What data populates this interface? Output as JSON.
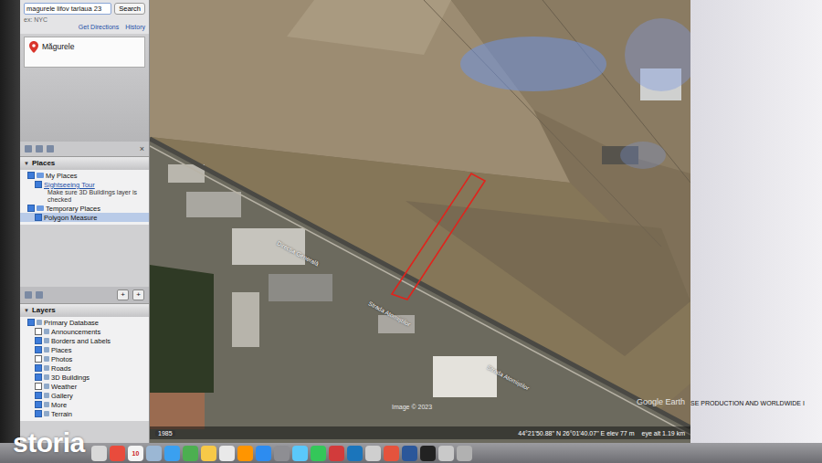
{
  "search": {
    "value": "magurele lifov tarlaua 23",
    "button": "Search",
    "hint": "ex: NYC",
    "links": [
      "Get Directions",
      "History"
    ]
  },
  "result": {
    "title": "Măgurele"
  },
  "toolbar": {
    "close": "×"
  },
  "places": {
    "toggle": "▼",
    "header": "Places",
    "items": [
      {
        "label": "My Places",
        "kind": "folder",
        "checked": true,
        "selected": false
      },
      {
        "label": "Sightseeing Tour",
        "kind": "link",
        "checked": true,
        "selected": false
      },
      {
        "label": "Make sure 3D Buildings layer is checked",
        "kind": "note",
        "checked": false,
        "selected": false
      },
      {
        "label": "Temporary Places",
        "kind": "folder",
        "checked": true,
        "selected": false
      },
      {
        "label": "Polygon Measure",
        "kind": "item",
        "checked": true,
        "selected": true
      }
    ]
  },
  "layers_toolbar": {
    "buttons": [
      "+",
      "+"
    ]
  },
  "layers": {
    "toggle": "▼",
    "header": "Layers",
    "items": [
      {
        "label": "Primary Database",
        "kind": "folder",
        "checked": true
      },
      {
        "label": "Announcements",
        "kind": "item",
        "checked": false
      },
      {
        "label": "Borders and Labels",
        "kind": "item",
        "checked": true
      },
      {
        "label": "Places",
        "kind": "item",
        "checked": true
      },
      {
        "label": "Photos",
        "kind": "item",
        "checked": false
      },
      {
        "label": "Roads",
        "kind": "item",
        "checked": true
      },
      {
        "label": "3D Buildings",
        "kind": "item",
        "checked": true
      },
      {
        "label": "Weather",
        "kind": "item",
        "checked": false
      },
      {
        "label": "Gallery",
        "kind": "item",
        "checked": true
      },
      {
        "label": "More",
        "kind": "item",
        "checked": true
      },
      {
        "label": "Terrain",
        "kind": "item",
        "checked": true
      }
    ]
  },
  "map": {
    "labels": [
      "Direcția Generală",
      "Strada Atomiștilor",
      "Strada Atomiștilor"
    ],
    "year": "1985",
    "copyright": "Image © 2023",
    "coords": "44°21'50.88\" N  26°01'40.07\" E  elev  77 m",
    "eye": "eye alt  1.19 km",
    "brand": "Google Earth"
  },
  "right": {
    "banner": "SE PRODUCTION AND WORLDWIDE I"
  },
  "watermark": {
    "text": "storia"
  },
  "dock": [
    {
      "color": "#d8d8d8",
      "label": ""
    },
    {
      "color": "#e94b3c",
      "label": ""
    },
    {
      "color": "#f4f4f4",
      "label": "10"
    },
    {
      "color": "#9bb7d4",
      "label": ""
    },
    {
      "color": "#3aa0f0",
      "label": ""
    },
    {
      "color": "#4caf50",
      "label": ""
    },
    {
      "color": "#f7c948",
      "label": ""
    },
    {
      "color": "#e9e9e9",
      "label": ""
    },
    {
      "color": "#ff9500",
      "label": ""
    },
    {
      "color": "#2d8cf0",
      "label": ""
    },
    {
      "color": "#8e8e93",
      "label": ""
    },
    {
      "color": "#5ac8fa",
      "label": ""
    },
    {
      "color": "#34c759",
      "label": ""
    },
    {
      "color": "#d23b3b",
      "label": ""
    },
    {
      "color": "#1b75bb",
      "label": ""
    },
    {
      "color": "#cfcfcf",
      "label": ""
    },
    {
      "color": "#e5533d",
      "label": ""
    },
    {
      "color": "#2b579a",
      "label": ""
    },
    {
      "color": "#222222",
      "label": ""
    },
    {
      "color": "#c9c9c9",
      "label": ""
    },
    {
      "color": "#b1b1b1",
      "label": ""
    }
  ]
}
